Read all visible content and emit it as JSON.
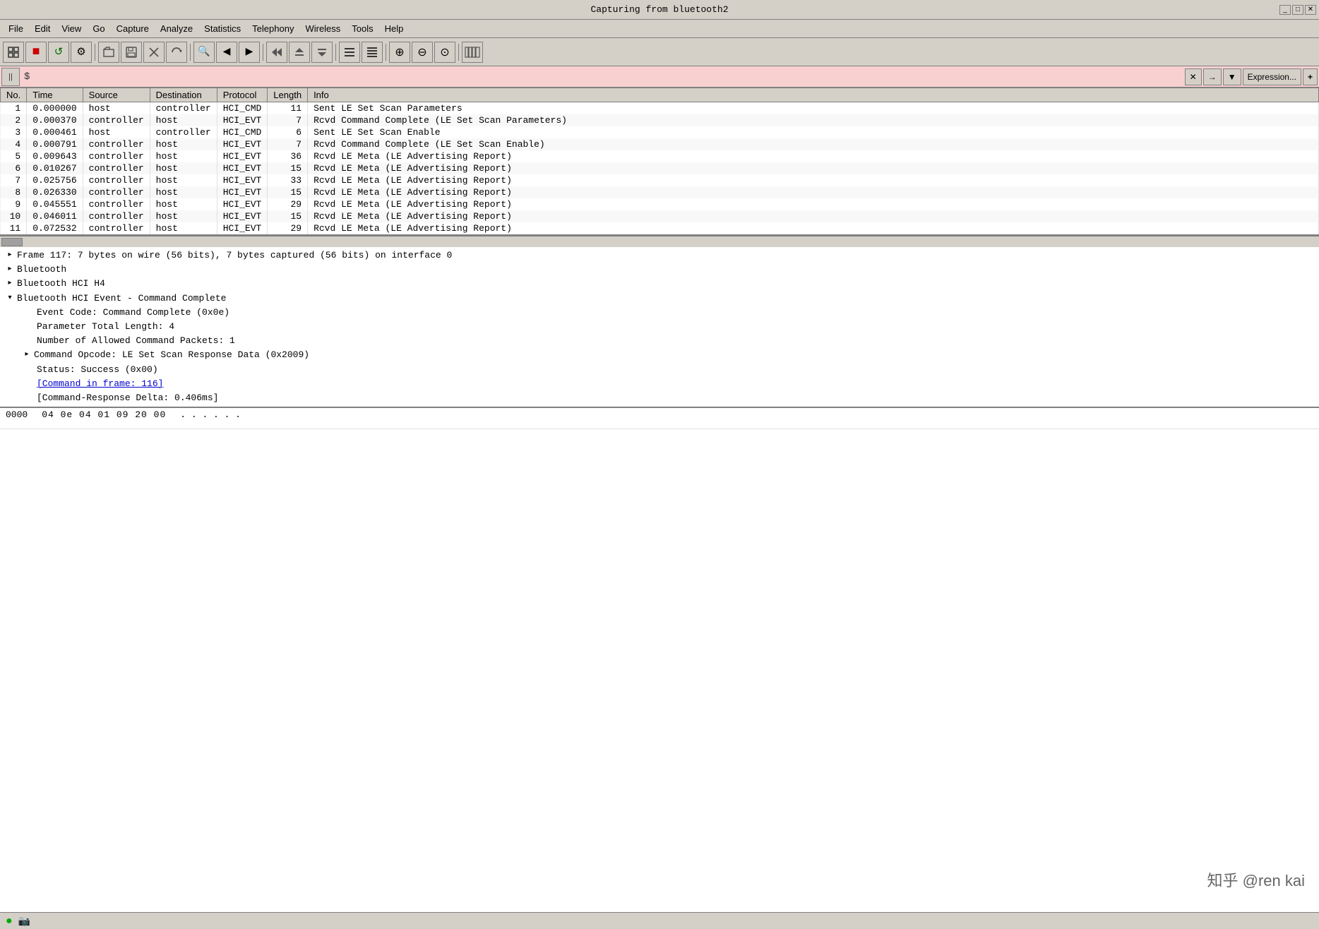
{
  "titlebar": {
    "title": "Capturing from bluetooth2",
    "minimize": "_",
    "maximize": "□",
    "close": "✕"
  },
  "menubar": {
    "items": [
      "File",
      "Edit",
      "View",
      "Go",
      "Capture",
      "Analyze",
      "Statistics",
      "Telephony",
      "Wireless",
      "Tools",
      "Help"
    ]
  },
  "toolbar": {
    "buttons": [
      {
        "name": "interface-icon",
        "symbol": "◈",
        "interactable": true
      },
      {
        "name": "stop-icon",
        "symbol": "■",
        "color": "red",
        "interactable": true
      },
      {
        "name": "restart-icon",
        "symbol": "↺",
        "color": "green",
        "interactable": true
      },
      {
        "name": "options-icon",
        "symbol": "⚙",
        "interactable": true
      },
      {
        "name": "open-icon",
        "symbol": "📂",
        "interactable": true
      },
      {
        "name": "save-icon",
        "symbol": "💾",
        "interactable": true
      },
      {
        "name": "close-file-icon",
        "symbol": "✕",
        "interactable": true
      },
      {
        "name": "reload-icon",
        "symbol": "⟳",
        "interactable": true
      },
      {
        "name": "find-icon",
        "symbol": "🔍",
        "interactable": true
      },
      {
        "name": "back-icon",
        "symbol": "◀",
        "interactable": true
      },
      {
        "name": "forward-icon",
        "symbol": "▶",
        "interactable": true
      },
      {
        "name": "go-first-icon",
        "symbol": "⏮",
        "interactable": true
      },
      {
        "name": "go-prev-icon",
        "symbol": "⬆",
        "interactable": true
      },
      {
        "name": "go-next-icon",
        "symbol": "⬇",
        "interactable": true
      },
      {
        "name": "colorize-icon",
        "symbol": "≡",
        "interactable": true
      },
      {
        "name": "auto-scroll-icon",
        "symbol": "≣",
        "interactable": true
      },
      {
        "name": "zoom-in-icon",
        "symbol": "⊕",
        "interactable": true
      },
      {
        "name": "zoom-out-icon",
        "symbol": "⊖",
        "interactable": true
      },
      {
        "name": "zoom-reset-icon",
        "symbol": "⊙",
        "interactable": true
      },
      {
        "name": "resize-columns-icon",
        "symbol": "⊞",
        "interactable": true
      }
    ]
  },
  "filter": {
    "icon": "||",
    "dollar_sign": "$",
    "placeholder": "",
    "value": "$",
    "expression_btn": "Expression...",
    "plus_btn": "+",
    "x_btn": "✕",
    "arrow_btn": "→",
    "dropdown_btn": "▼"
  },
  "packet_list": {
    "columns": [
      "No.",
      "Time",
      "Source",
      "Destination",
      "Protocol",
      "Length",
      "Info"
    ],
    "rows": [
      {
        "no": "1",
        "time": "0.000000",
        "source": "host",
        "destination": "controller",
        "protocol": "HCI_CMD",
        "length": "11",
        "info": "Sent LE Set Scan Parameters"
      },
      {
        "no": "2",
        "time": "0.000370",
        "source": "controller",
        "destination": "host",
        "protocol": "HCI_EVT",
        "length": "7",
        "info": "Rcvd Command Complete (LE Set Scan Parameters)"
      },
      {
        "no": "3",
        "time": "0.000461",
        "source": "host",
        "destination": "controller",
        "protocol": "HCI_CMD",
        "length": "6",
        "info": "Sent LE Set Scan Enable"
      },
      {
        "no": "4",
        "time": "0.000791",
        "source": "controller",
        "destination": "host",
        "protocol": "HCI_EVT",
        "length": "7",
        "info": "Rcvd Command Complete (LE Set Scan Enable)"
      },
      {
        "no": "5",
        "time": "0.009643",
        "source": "controller",
        "destination": "host",
        "protocol": "HCI_EVT",
        "length": "36",
        "info": "Rcvd LE Meta (LE Advertising Report)"
      },
      {
        "no": "6",
        "time": "0.010267",
        "source": "controller",
        "destination": "host",
        "protocol": "HCI_EVT",
        "length": "15",
        "info": "Rcvd LE Meta (LE Advertising Report)"
      },
      {
        "no": "7",
        "time": "0.025756",
        "source": "controller",
        "destination": "host",
        "protocol": "HCI_EVT",
        "length": "33",
        "info": "Rcvd LE Meta (LE Advertising Report)"
      },
      {
        "no": "8",
        "time": "0.026330",
        "source": "controller",
        "destination": "host",
        "protocol": "HCI_EVT",
        "length": "15",
        "info": "Rcvd LE Meta (LE Advertising Report)"
      },
      {
        "no": "9",
        "time": "0.045551",
        "source": "controller",
        "destination": "host",
        "protocol": "HCI_EVT",
        "length": "29",
        "info": "Rcvd LE Meta (LE Advertising Report)"
      },
      {
        "no": "10",
        "time": "0.046011",
        "source": "controller",
        "destination": "host",
        "protocol": "HCI_EVT",
        "length": "15",
        "info": "Rcvd LE Meta (LE Advertising Report)"
      },
      {
        "no": "11",
        "time": "0.072532",
        "source": "controller",
        "destination": "host",
        "protocol": "HCI_EVT",
        "length": "29",
        "info": "Rcvd LE Meta (LE Advertising Report)"
      }
    ]
  },
  "detail_pane": {
    "sections": [
      {
        "id": "frame",
        "expandable": true,
        "expanded": false,
        "indent": 0,
        "text": "Frame 117: 7 bytes on wire (56 bits), 7 bytes captured (56 bits) on interface 0"
      },
      {
        "id": "bluetooth",
        "expandable": true,
        "expanded": false,
        "indent": 0,
        "text": "Bluetooth"
      },
      {
        "id": "bluetooth-hci-h4",
        "expandable": true,
        "expanded": false,
        "indent": 0,
        "text": "Bluetooth HCI H4"
      },
      {
        "id": "bluetooth-hci-event",
        "expandable": true,
        "expanded": true,
        "indent": 0,
        "text": "Bluetooth HCI Event - Command Complete"
      },
      {
        "id": "event-code",
        "expandable": false,
        "expanded": false,
        "indent": 1,
        "text": "Event Code: Command Complete (0x0e)"
      },
      {
        "id": "param-length",
        "expandable": false,
        "expanded": false,
        "indent": 1,
        "text": "Parameter Total Length: 4"
      },
      {
        "id": "num-packets",
        "expandable": false,
        "expanded": false,
        "indent": 1,
        "text": "Number of Allowed Command Packets: 1"
      },
      {
        "id": "command-opcode",
        "expandable": true,
        "expanded": false,
        "indent": 1,
        "text": "Command Opcode: LE Set Scan Response Data (0x2009)"
      },
      {
        "id": "status",
        "expandable": false,
        "expanded": false,
        "indent": 1,
        "text": "Status: Success (0x00)"
      },
      {
        "id": "cmd-in-frame",
        "expandable": false,
        "expanded": false,
        "indent": 1,
        "text": "[Command in frame: 116]",
        "is_link": true
      },
      {
        "id": "cmd-response-delta",
        "expandable": false,
        "expanded": false,
        "indent": 1,
        "text": "[Command-Response Delta: 0.406ms]"
      }
    ]
  },
  "hex_pane": {
    "lines": [
      {
        "offset": "0000",
        "bytes": "04 0e 04 01 09 20 00",
        "ascii": ". . . . .   ."
      }
    ]
  },
  "status_bar": {
    "ready_icon": "●",
    "capture_icon": "📷",
    "file_text": ""
  },
  "watermark": "知乎 @ren kai"
}
